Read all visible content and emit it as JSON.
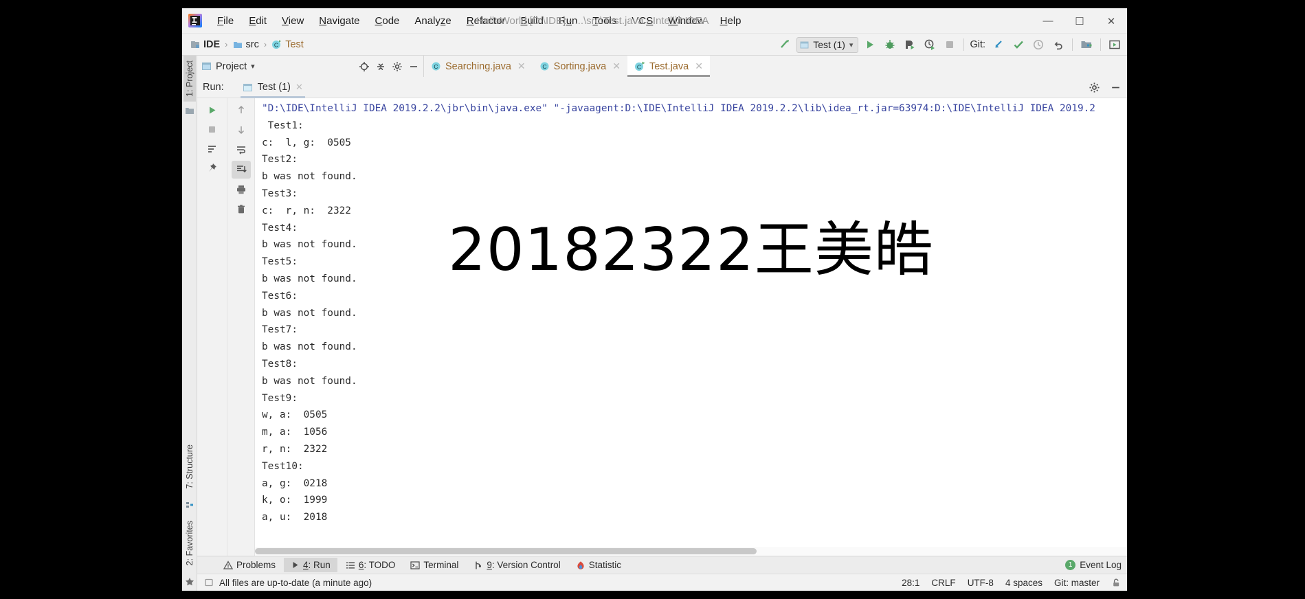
{
  "window": {
    "title": "HelloWorld [D:\\IDE] - ...\\src\\Test.java - IntelliJ IDEA",
    "minimize": "—",
    "maximize": "☐",
    "close": "✕"
  },
  "menu": [
    {
      "label": "File",
      "mnemonic": "F"
    },
    {
      "label": "Edit",
      "mnemonic": "E"
    },
    {
      "label": "View",
      "mnemonic": "V"
    },
    {
      "label": "Navigate",
      "mnemonic": "N"
    },
    {
      "label": "Code",
      "mnemonic": "C"
    },
    {
      "label": "Analyze",
      "mnemonic": "z"
    },
    {
      "label": "Refactor",
      "mnemonic": "R"
    },
    {
      "label": "Build",
      "mnemonic": "B"
    },
    {
      "label": "Run",
      "mnemonic": "u"
    },
    {
      "label": "Tools",
      "mnemonic": "T"
    },
    {
      "label": "VCS",
      "mnemonic": "S"
    },
    {
      "label": "Window",
      "mnemonic": "W"
    },
    {
      "label": "Help",
      "mnemonic": "H"
    }
  ],
  "navbar": {
    "breadcrumbs": [
      {
        "label": "IDE",
        "type": "module"
      },
      {
        "label": "src",
        "type": "folder"
      },
      {
        "label": "Test",
        "type": "class"
      }
    ],
    "separator": "›",
    "run_config": "Test (1)",
    "run_config_caret": "⌄",
    "git_label": "Git:",
    "actions": [
      "make-project-icon",
      "run-icon",
      "debug-icon",
      "run-with-coverage-icon",
      "stop-icon",
      "git-update-icon",
      "git-commit-icon",
      "git-history-icon",
      "git-rollback-icon",
      "project-structure-icon",
      "preview-icon"
    ]
  },
  "sidebar_left": {
    "tabs": [
      {
        "label": "1: Project",
        "number": "1",
        "active": true
      },
      {
        "label": "7: Structure",
        "number": "7",
        "active": false
      },
      {
        "label": "2: Favorites",
        "number": "2",
        "active": false
      }
    ]
  },
  "project_tool_window": {
    "title": "Project",
    "caret": "▾",
    "actions": [
      "locate-icon",
      "collapse-all-icon",
      "settings-gear-icon",
      "hide-icon"
    ]
  },
  "editor": {
    "tabs": [
      {
        "label": "Searching.java",
        "icon": "java-class-icon",
        "active": false,
        "close": "✕"
      },
      {
        "label": "Sorting.java",
        "icon": "java-class-icon",
        "active": false,
        "close": "✕"
      },
      {
        "label": "Test.java",
        "icon": "java-runnable-class-icon",
        "active": true,
        "close": "✕"
      }
    ]
  },
  "run_window": {
    "label": "Run:",
    "tab": "Test (1)",
    "tab_close": "✕",
    "header_actions": [
      "settings-gear-icon",
      "hide-window-icon"
    ],
    "left_toolbar": [
      "rerun-icon",
      "stop-icon",
      "filter-icon",
      "pin-icon"
    ],
    "gutter_actions": [
      "scroll-up-icon",
      "scroll-down-icon",
      "soft-wrap-icon",
      "scroll-to-end-icon",
      "print-icon",
      "clear-all-icon"
    ],
    "console_lines": [
      "\"D:\\IDE\\IntelliJ IDEA 2019.2.2\\jbr\\bin\\java.exe\" \"-javaagent:D:\\IDE\\IntelliJ IDEA 2019.2.2\\lib\\idea_rt.jar=63974:D:\\IDE\\IntelliJ IDEA 2019.2",
      " Test1:",
      "c:  l, g:  0505",
      "Test2:",
      "b was not found.",
      "Test3:",
      "c:  r, n:  2322",
      "Test4:",
      "b was not found.",
      "Test5:",
      "b was not found.",
      "Test6:",
      "b was not found.",
      "Test7:",
      "b was not found.",
      "Test8:",
      "b was not found.",
      "Test9:",
      "w, a:  0505",
      "m, a:  1056",
      "r, n:  2322",
      "Test10:",
      "a, g:  0218",
      "k, o:  1999",
      "a, u:  2018"
    ],
    "watermark": "20182322王美皓"
  },
  "bottom_tool_tabs": [
    {
      "label": "Problems",
      "icon": "warning-icon",
      "number": "",
      "active": false
    },
    {
      "label": "4: Run",
      "icon": "run-icon",
      "number": "4",
      "active": true
    },
    {
      "label": "6: TODO",
      "icon": "todo-icon",
      "number": "6",
      "active": false
    },
    {
      "label": "Terminal",
      "icon": "terminal-icon",
      "number": "",
      "active": false
    },
    {
      "label": "9: Version Control",
      "icon": "vcs-branch-icon",
      "number": "9",
      "active": false
    },
    {
      "label": "Statistic",
      "icon": "statistic-icon",
      "number": "",
      "active": false
    }
  ],
  "event_log": {
    "label": "Event Log",
    "badge": "1"
  },
  "statusbar": {
    "message": "All files are up-to-date (a minute ago)",
    "caret_position": "28:1",
    "line_separator": "CRLF",
    "encoding": "UTF-8",
    "indent": "4 spaces",
    "branch": "Git: master",
    "lock_icon": "lock-icon"
  },
  "colors": {
    "accent_green": "#59a869",
    "tab_text_orange": "#9b6b2e",
    "console_cmd_blue": "#3a46a0",
    "chrome_bg": "#f2f2f2"
  }
}
